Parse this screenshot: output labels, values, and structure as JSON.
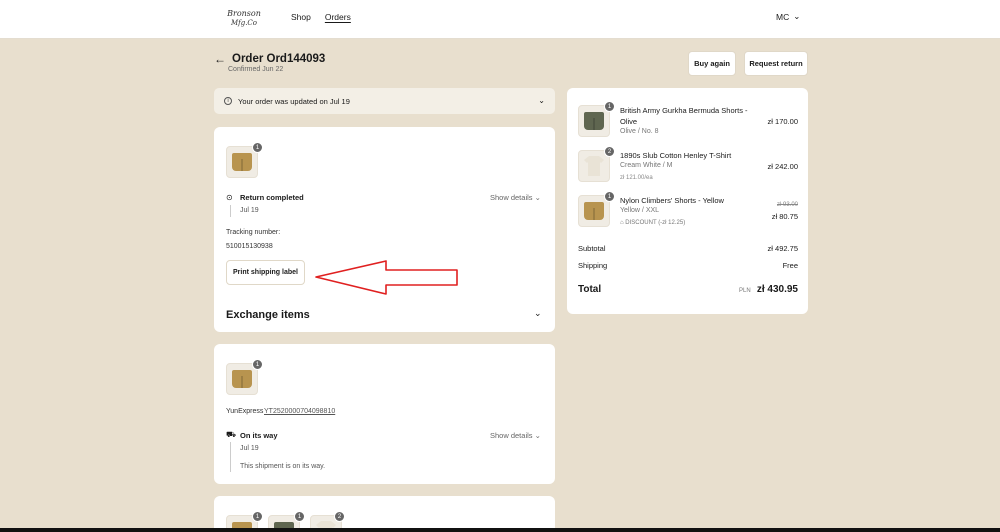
{
  "header": {
    "logo_text": "BRONSON MFG CO",
    "nav": [
      {
        "label": "Shop"
      },
      {
        "label": "Orders"
      }
    ],
    "account_initials": "MC"
  },
  "order": {
    "title": "Order Ord144093",
    "confirmed": "Confirmed Jun 22",
    "buy_again": "Buy again",
    "request_return": "Request return"
  },
  "banner": {
    "text": "Your order was updated on Jul 19"
  },
  "return_card": {
    "badge": "1",
    "status": "Return completed",
    "date": "Jul 19",
    "show_details": "Show details",
    "tracking_label": "Tracking number:",
    "tracking_number": "510015130938",
    "print_label": "Print shipping label",
    "exchange_title": "Exchange items"
  },
  "shipment_card": {
    "badge": "1",
    "carrier": "YunExpress",
    "tracking": "YT2520000704098810",
    "status": "On its way",
    "date": "Jul 19",
    "show_details": "Show details",
    "message": "This shipment is on its way."
  },
  "third_card": {
    "badges": [
      "1",
      "1",
      "2"
    ]
  },
  "summary": {
    "items": [
      {
        "badge": "1",
        "name_line1": "British Army Gurkha Bermuda Shorts -",
        "name_line2": "Olive",
        "variant": "Olive / No. 8",
        "price": "zł 170.00"
      },
      {
        "badge": "2",
        "name_line1": "1890s Slub Cotton Henley T-Shirt",
        "variant": "Cream White / M",
        "unit": "zł 121.00/ea",
        "price": "zł 242.00"
      },
      {
        "badge": "1",
        "name_line1": "Nylon Climbers' Shorts - Yellow",
        "variant": "Yellow / XXL",
        "discount": "DISCOUNT (-zł 12.25)",
        "original_price": "zł 93.00",
        "price": "zł 80.75"
      }
    ],
    "subtotal_label": "Subtotal",
    "subtotal": "zł 492.75",
    "shipping_label": "Shipping",
    "shipping": "Free",
    "total_label": "Total",
    "currency": "PLN",
    "total": "zł 430.95"
  },
  "colors": {
    "annotation_arrow": "#e02020",
    "background": "#e8dfce",
    "olive": "#5f6650",
    "yellow_short": "#b8944f"
  }
}
